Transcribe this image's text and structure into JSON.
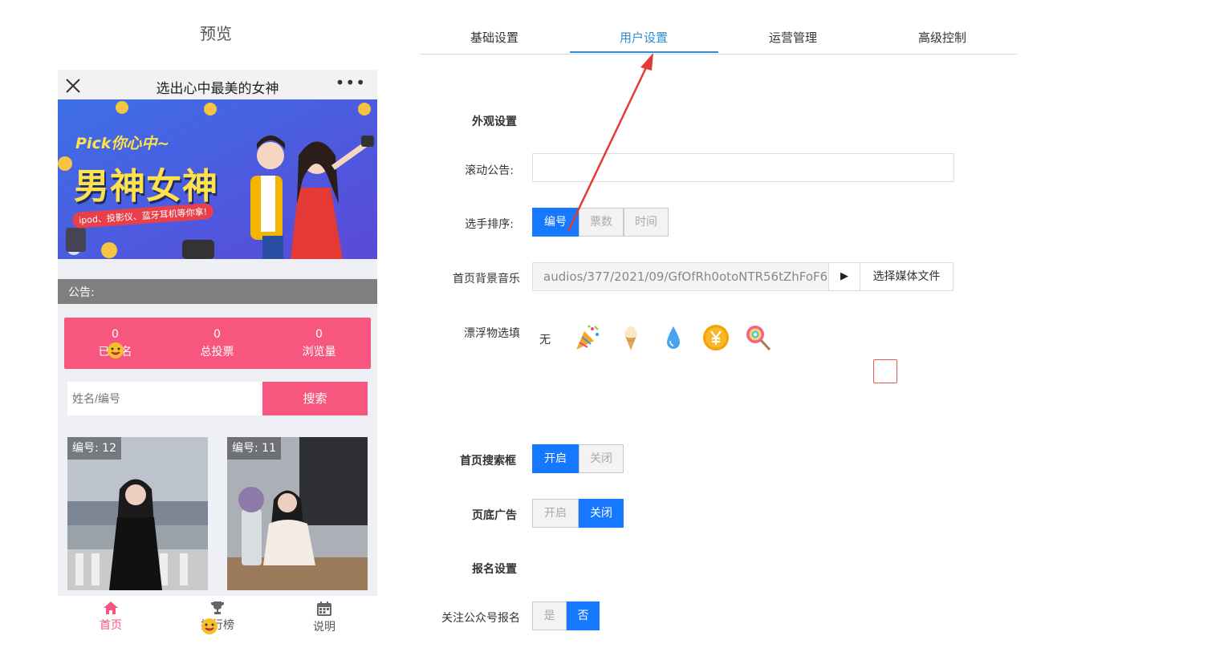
{
  "preview": {
    "title": "预览",
    "phone": {
      "title": "选出心中最美的女神",
      "more": "•••",
      "banner": {
        "line1": "Pick你心中~",
        "line2": "男神女神",
        "line3": "ipod、投影仪、蓝牙耳机等你拿!"
      },
      "notice": "公告:",
      "stats": [
        {
          "value": "0",
          "label": "已报名"
        },
        {
          "value": "0",
          "label": "总投票"
        },
        {
          "value": "0",
          "label": "浏览量"
        }
      ],
      "search_placeholder": "姓名/编号",
      "search_button": "搜索",
      "cards": [
        {
          "number": "编号: 12"
        },
        {
          "number": "编号: 11"
        }
      ],
      "tabbar": [
        {
          "label": "首页",
          "icon": "home-icon"
        },
        {
          "label": "排行榜",
          "icon": "trophy-icon"
        },
        {
          "label": "说明",
          "icon": "calendar-icon"
        }
      ]
    }
  },
  "tabs": [
    "基础设置",
    "用户设置",
    "运营管理",
    "高级控制"
  ],
  "active_tab": "用户设置",
  "settings": {
    "appearance_title": "外观设置",
    "scroll_notice_label": "滚动公告:",
    "scroll_notice_value": "",
    "sort_label": "选手排序:",
    "sort_options": [
      "编号",
      "票数",
      "时间"
    ],
    "sort_selected": "编号",
    "music_label": "首页背景音乐",
    "music_path": "audios/377/2021/09/GfOfRh0otoNTR56tZhFoF6",
    "music_play": "▶",
    "music_pick": "选择媒体文件",
    "float_label": "漂浮物选填",
    "float_none": "无",
    "float_icons": [
      "party-popper-icon",
      "ice-cream-icon",
      "water-drop-icon",
      "yen-coin-icon",
      "lollipop-icon"
    ],
    "search_label": "首页搜索框",
    "search_options": [
      "开启",
      "关闭"
    ],
    "search_selected": "开启",
    "footer_ad_label": "页底广告",
    "footer_ad_options": [
      "开启",
      "关闭"
    ],
    "footer_ad_selected": "关闭",
    "signup_title": "报名设置",
    "follow_label": "关注公众号报名",
    "follow_options": [
      "是",
      "否"
    ],
    "follow_selected": "否"
  },
  "colors": {
    "accent": "#2d8cd8",
    "pink": "#f7577e",
    "button_on": "#1677ff",
    "arrow": "#e53935"
  }
}
